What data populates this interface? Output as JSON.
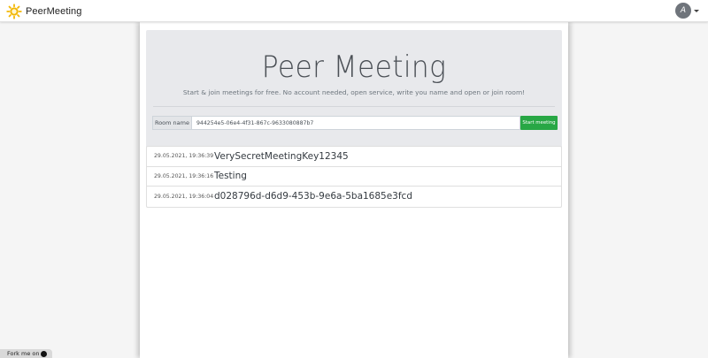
{
  "app": {
    "title": "PeerMeeting"
  },
  "nav": {
    "avatar_letter": "A"
  },
  "hero": {
    "title": "Peer Meeting",
    "subtitle": "Start & join meetings for free. No account needed, open service, write you name and open or join room!"
  },
  "room": {
    "label": "Room name",
    "value": "944254e5-06e4-4f31-867c-9633080887b7",
    "button": "Start meeting"
  },
  "meetings": [
    {
      "date": "29.05.2021, 19:36:39",
      "name": "VerySecretMeetingKey12345"
    },
    {
      "date": "29.05.2021, 19:36:16",
      "name": "Testing"
    },
    {
      "date": "29.05.2021, 19:36:04",
      "name": "d028796d-d6d9-453b-9e6a-5ba1685e3fcd"
    }
  ],
  "footer": {
    "fork_label": "Fork me on"
  },
  "colors": {
    "accent_green": "#28a745",
    "logo_yellow": "#f2b705"
  },
  "icons": {
    "logo": "sun-gear-logo-icon",
    "github": "github-icon",
    "caret": "caret-down-icon"
  }
}
